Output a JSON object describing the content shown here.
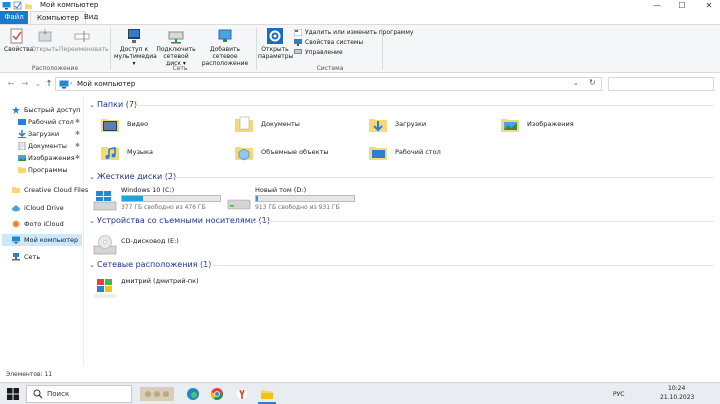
{
  "window": {
    "title": "Мой компьютер",
    "controls": {
      "minimize": "—",
      "maximize": "☐",
      "close": "✕"
    }
  },
  "ribbon": {
    "tabs": [
      "Файл",
      "Компьютер",
      "Вид"
    ],
    "groups": {
      "location": {
        "label": "Расположение",
        "buttons": [
          "Свойства",
          "Открыть",
          "Переименовать"
        ]
      },
      "network": {
        "label": "Сеть",
        "buttons": [
          "Доступ к мультимедиа ▾",
          "Подключить сетевой диск ▾",
          "Добавить сетевое расположение"
        ]
      },
      "system": {
        "label": "Система",
        "open_params": "Открыть параметры",
        "small": [
          "Удалить или изменить программу",
          "Свойства системы",
          "Управление"
        ]
      }
    }
  },
  "address": {
    "path": "Мой компьютер",
    "nav": {
      "back": "←",
      "forward": "→",
      "recent": "⌄",
      "up": "↑",
      "dropdown": "⌄",
      "refresh": "↻"
    }
  },
  "sidebar": {
    "items": [
      {
        "label": "Быстрый доступ"
      },
      {
        "label": "Рабочий стол"
      },
      {
        "label": "Загрузки"
      },
      {
        "label": "Документы"
      },
      {
        "label": "Изображения"
      },
      {
        "label": "Программы"
      },
      {
        "label": "Creative Cloud Files"
      },
      {
        "label": "iCloud Drive"
      },
      {
        "label": "Фото iCloud"
      },
      {
        "label": "Мой компьютер"
      },
      {
        "label": "Сеть"
      }
    ]
  },
  "main": {
    "sections": {
      "folders": "Папки (7)",
      "drives": "Жесткие диски (2)",
      "removable": "Устройства со съемными носителями (1)",
      "network": "Сетевые расположения (1)"
    },
    "folders": [
      {
        "label": "Видео"
      },
      {
        "label": "Документы"
      },
      {
        "label": "Загрузки"
      },
      {
        "label": "Изображения"
      },
      {
        "label": "Музыка"
      },
      {
        "label": "Объемные объекты"
      },
      {
        "label": "Рабочий стол"
      }
    ],
    "drives": [
      {
        "name": "Windows 10 (C:)",
        "size": "377 ГБ свободно из 476 ГБ",
        "used_fraction": 0.21
      },
      {
        "name": "Новый том (D:)",
        "size": "913 ГБ свободно из 931 ГБ",
        "used_fraction": 0.02
      }
    ],
    "removable": [
      {
        "name": "CD-дисковод (E:)"
      }
    ],
    "network_locations": [
      {
        "name": "дмитрий (дмитрий-пк)"
      }
    ]
  },
  "status": {
    "items_count": "Элементов: 11"
  },
  "taskbar": {
    "search_label": "Поиск",
    "tray": {
      "lang": "РУС",
      "time": "10:24",
      "date": "21.10.2023"
    }
  },
  "colors": {
    "accent": "#1979ca",
    "selection": "#cce8ff",
    "drive_fill": "#26a0da",
    "folder": "#f8d775"
  }
}
